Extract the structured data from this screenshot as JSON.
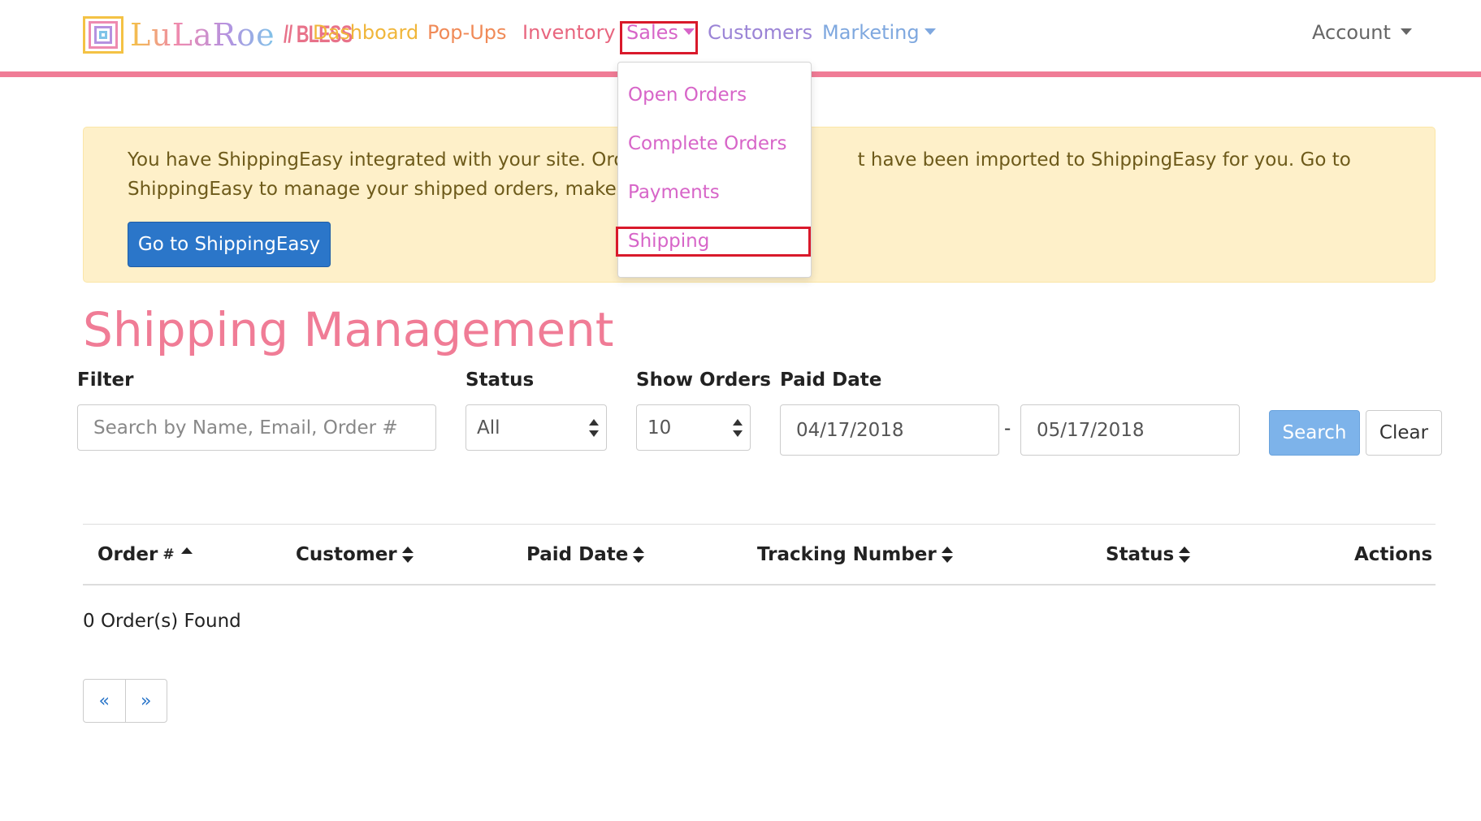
{
  "brand": {
    "logo_text": "LuLaRoe",
    "logo_suffix": "// BLESS"
  },
  "nav": {
    "items": [
      {
        "label": "Dashboard",
        "color": "#f0b63a"
      },
      {
        "label": "Pop-Ups",
        "color": "#f08a57"
      },
      {
        "label": "Inventory",
        "color": "#e8667f"
      },
      {
        "label": "Sales",
        "color": "#d765c8",
        "has_caret": true,
        "highlighted": true,
        "open": true
      },
      {
        "label": "Customers",
        "color": "#9b84d6"
      },
      {
        "label": "Marketing",
        "color": "#7fa8df",
        "has_caret": true
      }
    ],
    "account_label": "Account",
    "underline_color": "#f07c96"
  },
  "sales_dropdown": {
    "items": [
      {
        "label": "Open Orders"
      },
      {
        "label": "Complete Orders"
      },
      {
        "label": "Payments"
      },
      {
        "label": "Shipping",
        "highlighted": true
      }
    ]
  },
  "alert": {
    "line1_left": "You have ShippingEasy integrated with your site. Orders",
    "line1_right": "t have been imported to ShippingEasy for you. Go to",
    "line2": "ShippingEasy to manage your shipped orders, make lab",
    "button_label": "Go to ShippingEasy"
  },
  "page": {
    "title": "Shipping Management"
  },
  "filters": {
    "filter_label": "Filter",
    "filter_placeholder": "Search by Name, Email, Order #",
    "status_label": "Status",
    "status_value": "All",
    "show_orders_label": "Show Orders",
    "show_orders_value": "10",
    "paid_date_label": "Paid Date",
    "date_from": "04/17/2018",
    "date_separator": "-",
    "date_to": "05/17/2018",
    "search_button": "Search",
    "clear_button": "Clear"
  },
  "table": {
    "columns": [
      {
        "label": "Order",
        "suffix": "#",
        "sort": "asc"
      },
      {
        "label": "Customer",
        "sort": "both"
      },
      {
        "label": "Paid Date",
        "sort": "both"
      },
      {
        "label": "Tracking Number",
        "sort": "both"
      },
      {
        "label": "Status",
        "sort": "both"
      },
      {
        "label": "Actions",
        "sort": "none"
      }
    ],
    "rows": [],
    "result_text": "0 Order(s) Found"
  },
  "pagination": {
    "prev": "«",
    "next": "»"
  },
  "colors": {
    "accent_pink": "#f07c96",
    "primary_blue": "#2b76c9",
    "search_blue": "#7db3ea",
    "alert_bg": "#fef0c9",
    "highlight_red": "#d9192b"
  }
}
